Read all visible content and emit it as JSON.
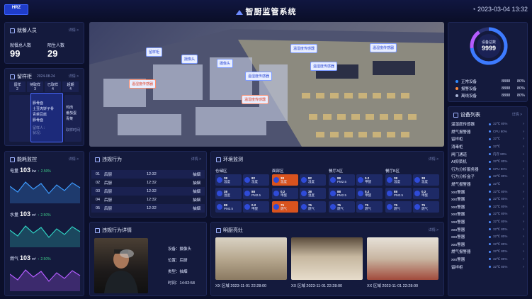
{
  "header": {
    "logo": "HRZ",
    "title": "智厨监管系统",
    "clock": "2023-03-04 13:32"
  },
  "diners": {
    "title": "就餐人员",
    "more": "详情 >",
    "total_label": "就餐总人数",
    "total": "99",
    "stranger_label": "陌生人数",
    "stranger": "29"
  },
  "sample": {
    "title": "留样柜",
    "more": "详情 >",
    "date": "2024-08-24",
    "cols": [
      {
        "label": "留样",
        "value": "2"
      },
      {
        "label": "待取样",
        "value": "3"
      },
      {
        "label": "已取样",
        "value": "4"
      },
      {
        "label": "超期",
        "value": "4"
      }
    ],
    "items": [
      "豚骨面",
      "土豆肉饼子骨",
      "青菜豆腐",
      "豚骨面"
    ],
    "side": [
      "鸡肉",
      "番茄蛋",
      "青菜"
    ],
    "footer": [
      "留样人：",
      "状况：",
      "取样时间"
    ]
  },
  "energy": {
    "title": "能耗监控",
    "more": "详情 >",
    "items": [
      {
        "label": "电量",
        "value": "103",
        "unit": "kw",
        "change": "2.50%",
        "color": "#3d9bff"
      },
      {
        "label": "水量",
        "value": "103",
        "unit": "m³",
        "change": "2.50%",
        "color": "#2fd1c2"
      },
      {
        "label": "燃气",
        "value": "103",
        "unit": "m³",
        "change": "2.50%",
        "color": "#b45cff"
      }
    ]
  },
  "violations": {
    "title": "违规行为",
    "more": "详情 >",
    "rows": [
      {
        "no": "01",
        "place": "后厨",
        "time": "12:32",
        "type": "抽烟"
      },
      {
        "no": "02",
        "place": "后厨",
        "time": "12:32",
        "type": "抽烟"
      },
      {
        "no": "03",
        "place": "后厨",
        "time": "12:32",
        "type": "抽烟"
      },
      {
        "no": "04",
        "place": "后厨",
        "time": "12:32",
        "type": "抽烟"
      },
      {
        "no": "05",
        "place": "后厨",
        "time": "12:32",
        "type": "抽烟"
      }
    ]
  },
  "detail": {
    "title": "违规行为详情",
    "more": "详情 >",
    "source": "设备：摄像头",
    "pos": "位置：后厨",
    "type": "类型：抽烟",
    "time_label": "时间：",
    "time": "14:02:58"
  },
  "env": {
    "title": "环境监测",
    "more": "详情 >",
    "zones": [
      "仓储区",
      "面部区",
      "餐厅A区",
      "餐厅B区"
    ],
    "cards": [
      [
        "38",
        "温度"
      ],
      [
        "82",
        "湿度"
      ],
      [
        "38",
        "温度"
      ],
      [
        "82",
        "湿度"
      ],
      [
        "88",
        "PM2.5"
      ],
      [
        "0.2",
        "甲醛"
      ],
      [
        "38",
        "温度"
      ],
      [
        "38",
        "温度"
      ],
      [
        "38",
        "温度"
      ],
      [
        "88",
        "PM2.5"
      ],
      [
        "0.2",
        "甲醛"
      ],
      [
        "38",
        "温度"
      ],
      [
        "88",
        "PM2.5"
      ],
      [
        "0.2",
        "甲醛"
      ],
      [
        "88",
        "PM2.5"
      ],
      [
        "0.2",
        "甲醛"
      ],
      [
        "88",
        "PM2.5"
      ],
      [
        "0.2",
        "甲醛"
      ],
      [
        "75",
        "燃气"
      ],
      [
        "75",
        "燃气"
      ],
      [
        "75",
        "燃气"
      ],
      [
        "75",
        "燃气"
      ],
      [
        "75",
        "燃气"
      ],
      [
        "75",
        "燃气"
      ],
      [
        "75",
        "燃气"
      ],
      [
        "75",
        "燃气"
      ]
    ]
  },
  "kitchen": {
    "title": "明厨亮灶",
    "more": "详情 >",
    "cams": [
      {
        "label": "XX 区域  2023-11-01 22:28:00"
      },
      {
        "label": "XX 区域  2023-11-01 22:28:00"
      },
      {
        "label": "XX 区域  2023-11-01 22:28:00"
      }
    ]
  },
  "devices": {
    "gauge_label": "设备总数",
    "total": "9999",
    "legend": [
      {
        "label": "正常设备",
        "value": "8888",
        "pct": "80%",
        "color": "#2f8bff"
      },
      {
        "label": "报警设备",
        "value": "8888",
        "pct": "80%",
        "color": "#ff8c3d"
      },
      {
        "label": "离线设备",
        "value": "8888",
        "pct": "80%",
        "color": "#a9b4d6"
      }
    ],
    "list_title": "设备列表",
    "more": "详情 >",
    "list": [
      [
        "温湿度传感器",
        "32℃ 80%"
      ],
      [
        "燃气报警器",
        "CPU 80%"
      ],
      [
        "留样柜",
        "32℃"
      ],
      [
        "消毒柜",
        "32℃"
      ],
      [
        "闸门通道",
        "内存 80%"
      ],
      [
        "AI抑菜机",
        "32℃ 80%"
      ],
      [
        "行为分析服务器",
        "CPU 80%"
      ],
      [
        "行为分析盒子",
        "32℃ 80%"
      ],
      [
        "燃气报警器",
        "32℃"
      ],
      [
        "xxx警器",
        "32℃ 80%"
      ],
      [
        "xxx警器",
        "32℃ 80%"
      ],
      [
        "xxx警器",
        "32℃ 80%"
      ],
      [
        "xxx警器",
        "32℃ 80%"
      ],
      [
        "xxx警器",
        "32℃ 80%"
      ],
      [
        "xxx警器",
        "32℃ 80%"
      ],
      [
        "xxx警器",
        "32℃ 80%"
      ],
      [
        "xxx警器",
        "32℃ 80%"
      ],
      [
        "燃气报警器",
        "32℃ 80%"
      ],
      [
        "xxx警器",
        "32℃ 80%"
      ],
      [
        "留样柜",
        "32℃ 80%"
      ]
    ]
  },
  "map_tags": [
    {
      "text": "留样柜",
      "warn": false
    },
    {
      "text": "摄像头",
      "warn": false
    },
    {
      "text": "摄像头",
      "warn": false
    },
    {
      "text": "温湿度传感器",
      "warn": false
    },
    {
      "text": "温湿度传感器",
      "warn": false
    },
    {
      "text": "温湿度传感器",
      "warn": true
    },
    {
      "text": "温湿度传感器",
      "warn": false
    },
    {
      "text": "温湿度传感器",
      "warn": true
    },
    {
      "text": "温湿度传感器",
      "warn": false
    }
  ]
}
